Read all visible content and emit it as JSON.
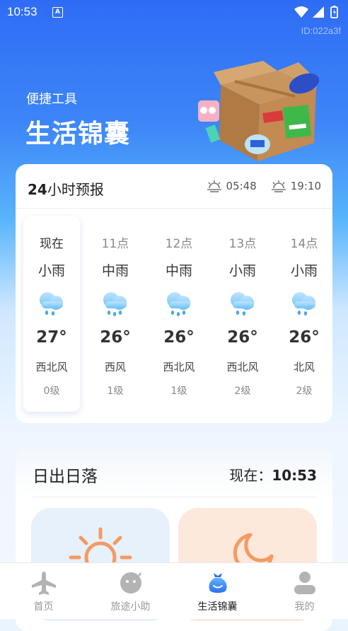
{
  "status_bar": {
    "time": "10:53",
    "notification_badge": "A"
  },
  "device_id": "ID:022a3f",
  "header": {
    "subtitle": "便捷工具",
    "title": "生活锦囊"
  },
  "forecast": {
    "title_bold": "24",
    "title_rest": "小时预报",
    "sunrise": "05:48",
    "sunset": "19:10",
    "hours": [
      {
        "time": "现在",
        "condition": "小雨",
        "temp": "27°",
        "wind": "西北风",
        "level": "0级",
        "icon": "light-rain-icon"
      },
      {
        "time": "11点",
        "condition": "中雨",
        "temp": "26°",
        "wind": "西风",
        "level": "1级",
        "icon": "moderate-rain-icon"
      },
      {
        "time": "12点",
        "condition": "中雨",
        "temp": "26°",
        "wind": "西北风",
        "level": "1级",
        "icon": "moderate-rain-icon"
      },
      {
        "time": "13点",
        "condition": "小雨",
        "temp": "26°",
        "wind": "西北风",
        "level": "2级",
        "icon": "light-rain-icon"
      },
      {
        "time": "14点",
        "condition": "小雨",
        "temp": "26°",
        "wind": "北风",
        "level": "2级",
        "icon": "light-rain-icon"
      }
    ]
  },
  "sun": {
    "title": "日出日落",
    "now_label": "现在：",
    "now_time": "10:53"
  },
  "nav": {
    "items": [
      {
        "label": "首页",
        "icon": "airplane-icon"
      },
      {
        "label": "旅途小助",
        "icon": "assistant-icon"
      },
      {
        "label": "生活锦囊",
        "icon": "bag-icon"
      },
      {
        "label": "我的",
        "icon": "user-icon"
      }
    ],
    "active_index": 2
  },
  "colors": {
    "accent": "#3a78f6",
    "sunrise_tile": "#e6f1fc",
    "sunset_tile": "#fde8dc",
    "orange": "#f59a62"
  }
}
